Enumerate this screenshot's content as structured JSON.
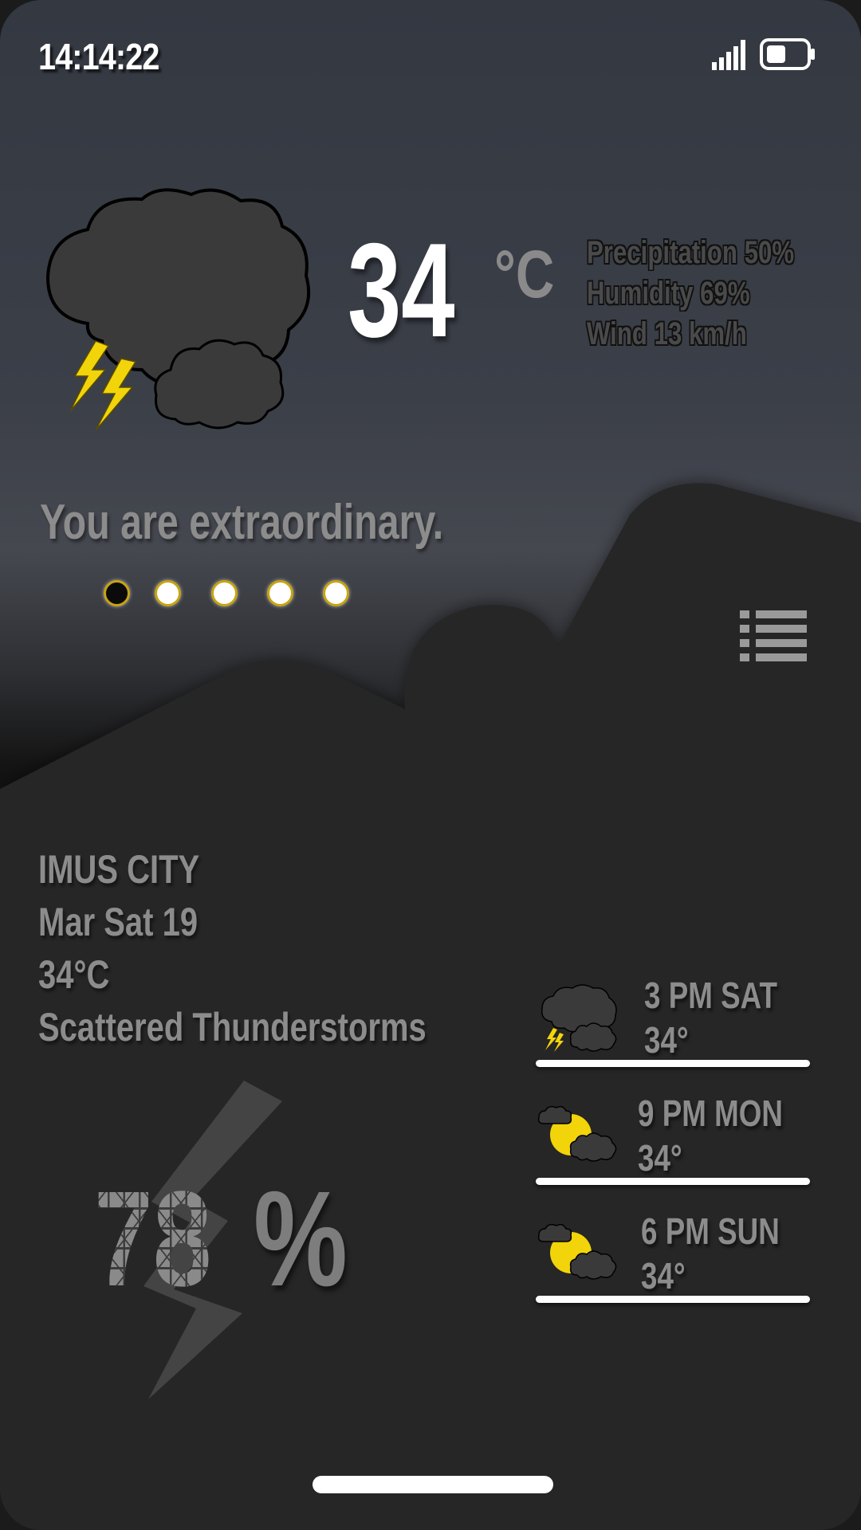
{
  "status_bar": {
    "time": "14:14:22",
    "signal_icon": "cellular-signal-icon",
    "battery_icon": "battery-icon",
    "battery_level": 0.5
  },
  "current": {
    "icon": "thunderstorm-cloud-icon",
    "temperature": "34",
    "unit": "°C",
    "details": [
      "Precipitation 50%",
      "Humidity 69%",
      "Wind 13 km/h"
    ]
  },
  "quote": "You are extraordinary.",
  "pager": {
    "count": 5,
    "active_index": 0
  },
  "menu_icon": "list-menu-icon",
  "location": {
    "city": "IMUS CITY",
    "date": "Mar Sat 19",
    "temperature": "34°C",
    "condition": "Scattered Thunderstorms"
  },
  "percent": {
    "value": "78",
    "sign": "%",
    "icon": "lightning-bolt-icon"
  },
  "forecast": [
    {
      "time": "3 PM SAT",
      "temp": "34°",
      "icon": "thunderstorm-cloud-icon"
    },
    {
      "time": "9 PM MON",
      "temp": "34°",
      "icon": "partly-cloudy-icon"
    },
    {
      "time": "6 PM SUN",
      "temp": "34°",
      "icon": "partly-cloudy-icon"
    }
  ],
  "colors": {
    "accent_yellow": "#f2d40a",
    "text_gray": "#8c8c8c",
    "panel_dark": "#262626"
  }
}
